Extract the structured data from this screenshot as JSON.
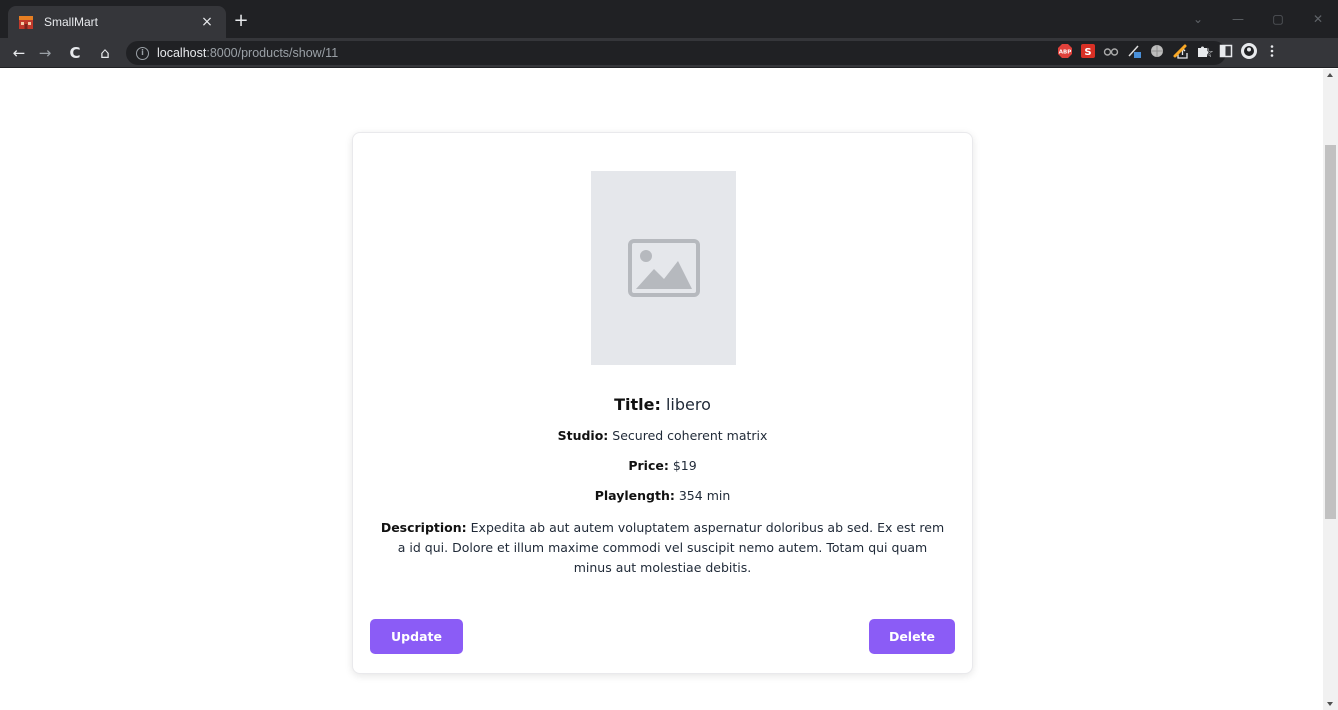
{
  "browser": {
    "tab_title": "SmallMart",
    "tab_close": "×",
    "new_tab": "+",
    "url_host": "localhost",
    "url_path": ":8000/products/show/11",
    "window_controls": {
      "minimize": "—",
      "restore": "▢",
      "close": "✕",
      "dropdown": "⌄"
    },
    "nav": {
      "back": "←",
      "forward": "→",
      "reload": "C",
      "home": "⌂"
    },
    "icons": [
      "share-icon",
      "bookmark-star-icon",
      "adblock-icon",
      "s-extension-icon",
      "glasses-extension-icon",
      "pen-extension-icon",
      "globe-extension-icon",
      "pencil-extension-icon",
      "extensions-puzzle-icon",
      "side-panel-icon",
      "profile-icon",
      "menu-kebab-icon"
    ],
    "ext_abp": "ABP",
    "ext_s": "S",
    "accent_colors": {
      "abp": "#e0413b",
      "s_ext": "#d93025",
      "pencil": "#f9a825"
    }
  },
  "product": {
    "title_label": "Title:",
    "title": "libero",
    "studio_label": "Studio:",
    "studio": "Secured coherent matrix",
    "price_label": "Price:",
    "price": "$19",
    "playlength_label": "Playlength:",
    "playlength": "354 min",
    "description_label": "Description:",
    "description": "Expedita ab aut autem voluptatem aspernatur doloribus ab sed. Ex est rem a id qui. Dolore et illum maxime commodi vel suscipit nemo autem. Totam qui quam minus aut molestiae debitis."
  },
  "actions": {
    "update_label": "Update",
    "delete_label": "Delete",
    "button_color": "#8b5cf6"
  }
}
